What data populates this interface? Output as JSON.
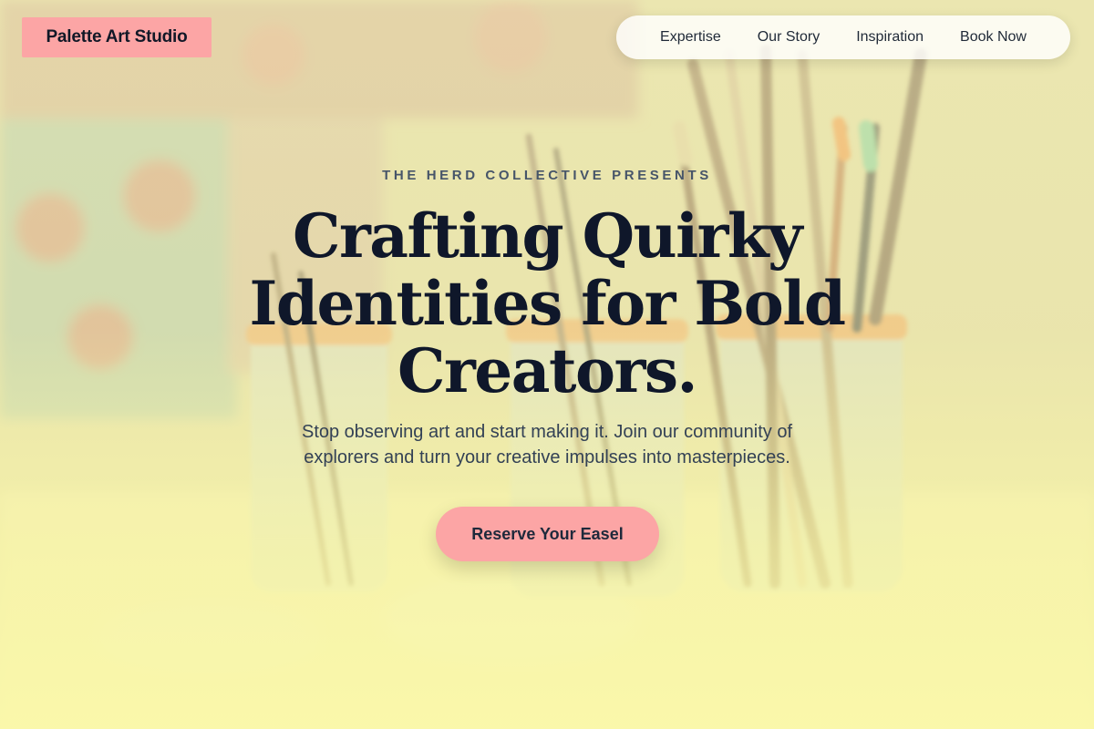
{
  "brand": {
    "name": "Palette Art Studio"
  },
  "nav": {
    "items": [
      {
        "label": "Expertise"
      },
      {
        "label": "Our Story"
      },
      {
        "label": "Inspiration"
      },
      {
        "label": "Book Now"
      }
    ]
  },
  "hero": {
    "kicker": "THE HERD COLLECTIVE PRESENTS",
    "headline": "Crafting Quirky Identities for Bold Creators.",
    "subtitle": "Stop observing art and start making it. Join our community of explorers and turn your creative impulses into masterpieces.",
    "cta_label": "Reserve Your Easel",
    "background": "paint-brushes-in-jars-photo"
  },
  "colors": {
    "accent": "#fca5a5",
    "overlay": "#f7f2a8",
    "heading": "#0f172a",
    "body": "#334155"
  }
}
